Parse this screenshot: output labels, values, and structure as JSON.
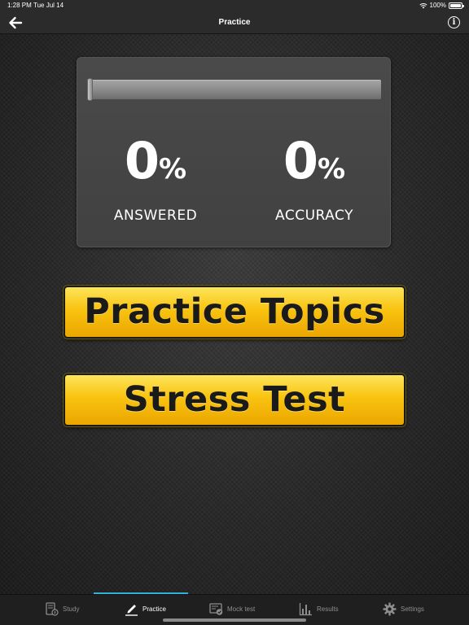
{
  "status_bar": {
    "time": "1:28 PM",
    "date": "Tue Jul 14",
    "battery": "100%"
  },
  "nav": {
    "title": "Practice",
    "back_icon": "arrow-left-icon",
    "info_icon": "info-icon",
    "info_glyph": "i"
  },
  "stats": {
    "progress": 0,
    "answered": {
      "value": "0",
      "unit": "%",
      "label": "ANSWERED"
    },
    "accuracy": {
      "value": "0",
      "unit": "%",
      "label": "ACCURACY"
    }
  },
  "buttons": {
    "practice_topics": "Practice Topics",
    "stress_test": "Stress Test"
  },
  "colors": {
    "button_yellow": "#f9c310",
    "tab_active_indicator": "#2fb2d8",
    "tab_inactive": "#8e8e8e"
  },
  "tabs": [
    {
      "label": "Study",
      "icon": "study-icon",
      "active": false
    },
    {
      "label": "Practice",
      "icon": "pencil-icon",
      "active": true
    },
    {
      "label": "Mock test",
      "icon": "mock-test-icon",
      "active": false
    },
    {
      "label": "Results",
      "icon": "bar-chart-icon",
      "active": false
    },
    {
      "label": "Settings",
      "icon": "gear-icon",
      "active": false
    }
  ]
}
